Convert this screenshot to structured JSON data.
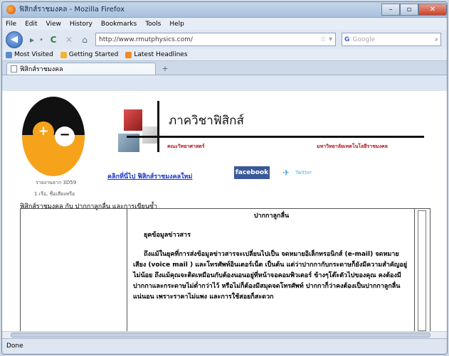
{
  "window": {
    "title": "ฟิสิกส์ราชมงคล - Mozilla Firefox",
    "min": "–",
    "max": "▫",
    "close": "✕"
  },
  "menu": [
    "File",
    "Edit",
    "View",
    "History",
    "Bookmarks",
    "Tools",
    "Help"
  ],
  "nav": {
    "back": "◀",
    "forward": "▸",
    "dropdown": "▾",
    "reload": "C",
    "stop": "✕",
    "home": "⌂",
    "url": "http://www.rmutphysics.com/",
    "star": "☆ ▾",
    "search_engine": "G",
    "search_placeholder": "Google",
    "search_icon": "⌕"
  },
  "bookmarks": [
    "Most Visited",
    "Getting Started",
    "Latest Headlines"
  ],
  "tab": {
    "label": "ฟิสิกส์ราชมงคล",
    "new": "+"
  },
  "page": {
    "under_logo_1": "รายงานจาก 3D59",
    "under_logo_2": "1 เรือ, ชื่อเสียงหรือ",
    "dept_title": "ภาควิชาฟิสิกส์",
    "sub_left": "คณะวิทยาศาสตร์",
    "sub_right": "มหาวิทยาลัยเทคโนโลยีราชมงคล",
    "click_link": "คลิกที่นี่ไป ฟิสิกส์ราชมงคลใหม่",
    "facebook": "facebook",
    "twitter_icon": "✈",
    "twitter": "Twitter",
    "breadcrumb": "ฟิสิกส์ราชมงคล กับ ปากกาลูกลื่น และการเขียนซ้ำ",
    "article_title": "ปากกาลูกลื่น",
    "article_sub": "ยุคข้อมูลข่าวสาร",
    "article_body": "ถึงแม้ในยุคที่การส่งข้อมูลข่าวสารจะเปลี่ยนไปเป็น จดหมายอิเล็กทรอนิกส์ (e-mail) จดหมายเสียง (voice mail ) และโทรศัพท์อินเตอร์เน็ต เป็นต้น แต่ว่าปากกากับกระดาษก็ยังมีความสำคัญอยู่ไม่น้อย ถึงแม้คุณจะติดเหมือนกับต้องนอนอยู่ที่หน้าจอคอมพิวเตอร์ ข้างๆโต๊ะตัวไปของคุณ คงต้องมีปากกาและกระดาษไม่ต่ำกว่าไว้ หรือไม่ก็ต้องมีสมุดจดโทรศัพท์ ปากกาก็ว่าคงต้องเป็นปากกาลูกลื่นแน่นอน เพราะราคาไม่แพง และการใช้สอยก็สะดวก"
  },
  "status": "Done"
}
